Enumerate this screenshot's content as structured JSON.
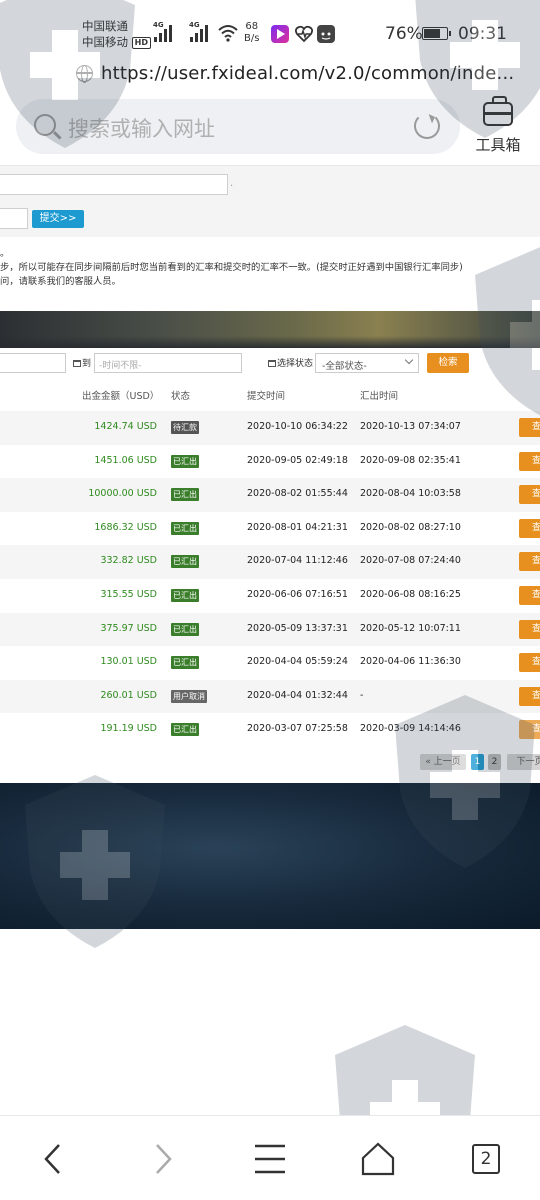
{
  "status_bar": {
    "carrier_1": "中国联通",
    "carrier_2": "中国移动",
    "hd_badge": "HD",
    "sig1_label": "4G",
    "sig2_label": "4G",
    "net_speed_value": "68",
    "net_speed_unit": "B/s",
    "battery_percent": "76%",
    "battery_level": 0.76,
    "time": "09:31"
  },
  "browser": {
    "url": "https://user.fxideal.com/v2.0/common/inde...",
    "search_placeholder": "搜索或输入网址",
    "toolbox_label": "工具箱",
    "tab_count": "2"
  },
  "form": {
    "submit_label": "提交>>",
    "notice_line1": "。",
    "notice_line2": "步，所以可能存在同步间隔前后时您当前看到的汇率和提交时的汇率不一致。(提交时正好遇到中国银行汇率同步)",
    "notice_line3": "问，请联系我们的客服人员。"
  },
  "filters": {
    "to_label": "到",
    "end_placeholder": "-时间不限-",
    "status_label": "选择状态",
    "status_selected": "-全部状态-",
    "search_button": "检索"
  },
  "table": {
    "headers": {
      "amount": "出金金额（USD）",
      "status": "状态",
      "submit_time": "提交时间",
      "remit_time": "汇出时间"
    },
    "view_label": "查",
    "rows": [
      {
        "amount": "1424.74 USD",
        "status": "待汇款",
        "status_type": "pending",
        "submit_time": "2020-10-10 06:34:22",
        "remit_time": "2020-10-13 07:34:07"
      },
      {
        "amount": "1451.06 USD",
        "status": "已汇出",
        "status_type": "done",
        "submit_time": "2020-09-05 02:49:18",
        "remit_time": "2020-09-08 02:35:41"
      },
      {
        "amount": "10000.00 USD",
        "status": "已汇出",
        "status_type": "done",
        "submit_time": "2020-08-02 01:55:44",
        "remit_time": "2020-08-04 10:03:58"
      },
      {
        "amount": "1686.32 USD",
        "status": "已汇出",
        "status_type": "done",
        "submit_time": "2020-08-01 04:21:31",
        "remit_time": "2020-08-02 08:27:10"
      },
      {
        "amount": "332.82 USD",
        "status": "已汇出",
        "status_type": "done",
        "submit_time": "2020-07-04 11:12:46",
        "remit_time": "2020-07-08 07:24:40"
      },
      {
        "amount": "315.55 USD",
        "status": "已汇出",
        "status_type": "done",
        "submit_time": "2020-06-06 07:16:51",
        "remit_time": "2020-06-08 08:16:25"
      },
      {
        "amount": "375.97 USD",
        "status": "已汇出",
        "status_type": "done",
        "submit_time": "2020-05-09 13:37:31",
        "remit_time": "2020-05-12 10:07:11"
      },
      {
        "amount": "130.01 USD",
        "status": "已汇出",
        "status_type": "done",
        "submit_time": "2020-04-04 05:59:24",
        "remit_time": "2020-04-06 11:36:30"
      },
      {
        "amount": "260.01 USD",
        "status": "用户取消",
        "status_type": "cancel",
        "submit_time": "2020-04-04 01:32:44",
        "remit_time": "-"
      },
      {
        "amount": "191.19 USD",
        "status": "已汇出",
        "status_type": "done",
        "submit_time": "2020-03-07 07:25:58",
        "remit_time": "2020-03-09 14:14:46"
      }
    ]
  },
  "pagination": {
    "prev": "« 上一页",
    "page1": "1",
    "page2": "2",
    "next": "下一页"
  },
  "colors": {
    "primary_blue": "#1d9bd1",
    "action_orange": "#e8901f",
    "amount_green": "#2e8b1e",
    "status_green": "#3a7d2a"
  }
}
